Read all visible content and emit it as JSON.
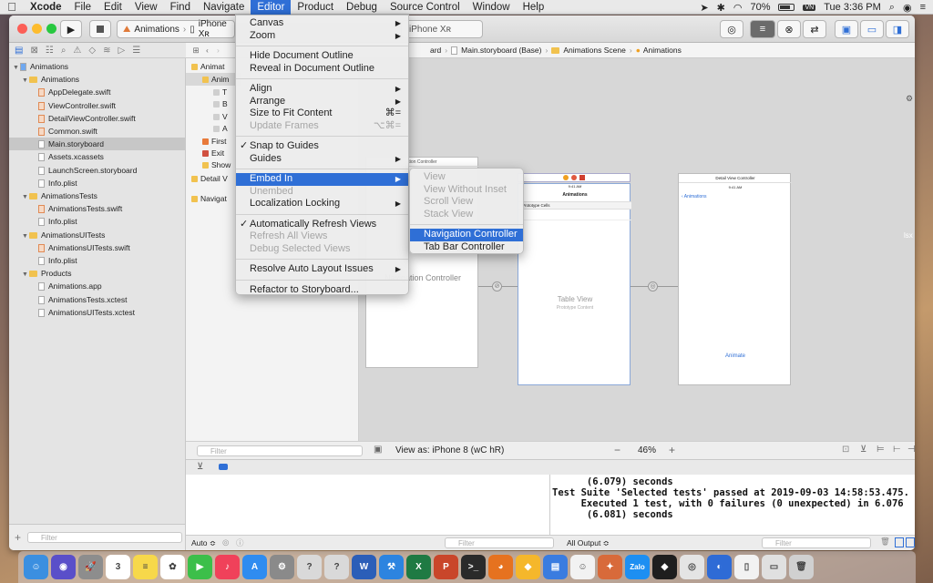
{
  "menubar": {
    "items": [
      "Xcode",
      "File",
      "Edit",
      "View",
      "Find",
      "Navigate",
      "Editor",
      "Product",
      "Debug",
      "Source Control",
      "Window",
      "Help"
    ],
    "battery": "70%",
    "clock": "Tue 3:36 PM"
  },
  "toolbar": {
    "scheme": "Animations",
    "device": "iPhone Xʀ"
  },
  "jumpbar": {
    "crumbs": [
      "ard",
      "Main.storyboard (Base)",
      "Animations Scene",
      "Animations"
    ]
  },
  "navigator": {
    "items": [
      {
        "label": "Animations",
        "type": "project",
        "indent": 0
      },
      {
        "label": "Animations",
        "type": "folder",
        "indent": 1
      },
      {
        "label": "AppDelegate.swift",
        "type": "swift",
        "indent": 2
      },
      {
        "label": "ViewController.swift",
        "type": "swift",
        "indent": 2
      },
      {
        "label": "DetailViewController.swift",
        "type": "swift",
        "indent": 2
      },
      {
        "label": "Common.swift",
        "type": "swift",
        "indent": 2
      },
      {
        "label": "Main.storyboard",
        "type": "storyboard",
        "indent": 2,
        "selected": true
      },
      {
        "label": "Assets.xcassets",
        "type": "assets",
        "indent": 2
      },
      {
        "label": "LaunchScreen.storyboard",
        "type": "storyboard",
        "indent": 2
      },
      {
        "label": "Info.plist",
        "type": "plist",
        "indent": 2
      },
      {
        "label": "AnimationsTests",
        "type": "folder",
        "indent": 1
      },
      {
        "label": "AnimationsTests.swift",
        "type": "swift",
        "indent": 2
      },
      {
        "label": "Info.plist",
        "type": "plist",
        "indent": 2
      },
      {
        "label": "AnimationsUITests",
        "type": "folder",
        "indent": 1
      },
      {
        "label": "AnimationsUITests.swift",
        "type": "swift",
        "indent": 2
      },
      {
        "label": "Info.plist",
        "type": "plist",
        "indent": 2
      },
      {
        "label": "Products",
        "type": "folder",
        "indent": 1
      },
      {
        "label": "Animations.app",
        "type": "app",
        "indent": 2
      },
      {
        "label": "AnimationsTests.xctest",
        "type": "file",
        "indent": 2
      },
      {
        "label": "AnimationsUITests.xctest",
        "type": "file",
        "indent": 2
      }
    ],
    "filter_placeholder": "Filter"
  },
  "outline": {
    "items": [
      {
        "label": "Animat",
        "indent": 0
      },
      {
        "label": "Anim",
        "indent": 1
      },
      {
        "label": "T",
        "indent": 2
      },
      {
        "label": "B",
        "indent": 2
      },
      {
        "label": "V",
        "indent": 2
      },
      {
        "label": "A",
        "indent": 2
      },
      {
        "label": "First",
        "indent": 1
      },
      {
        "label": "Exit",
        "indent": 1
      },
      {
        "label": "Show",
        "indent": 1
      },
      {
        "label": "Detail V",
        "indent": 0
      },
      {
        "label": "Navigat",
        "indent": 0
      }
    ],
    "filter_placeholder": "Filter"
  },
  "canvas": {
    "nav_controller_label": "Navigation Controller",
    "nav_scene_title": "tion Controller",
    "table_scene": {
      "time": "9:41 AM",
      "title": "Animations",
      "section": "Prototype Cells",
      "center": "Table View",
      "center_sub": "Prototype Content"
    },
    "detail_scene": {
      "header": "Detail View Controller",
      "time": "9:41 AM",
      "back": "Animations",
      "button": "Animate"
    },
    "view_as": "View as: iPhone 8 (wC hR)",
    "zoom": "46%",
    "side_fragment": "lsx"
  },
  "editor_menu": {
    "items": [
      {
        "label": "Canvas",
        "submenu": true
      },
      {
        "label": "Zoom",
        "submenu": true
      },
      {
        "sep": true
      },
      {
        "label": "Hide Document Outline"
      },
      {
        "label": "Reveal in Document Outline"
      },
      {
        "sep": true
      },
      {
        "label": "Align",
        "submenu": true
      },
      {
        "label": "Arrange",
        "submenu": true
      },
      {
        "label": "Size to Fit Content",
        "shortcut": "⌘="
      },
      {
        "label": "Update Frames",
        "shortcut": "⌥⌘=",
        "disabled": true
      },
      {
        "sep": true
      },
      {
        "label": "Snap to Guides",
        "checked": true
      },
      {
        "label": "Guides",
        "submenu": true
      },
      {
        "sep": true
      },
      {
        "label": "Embed In",
        "submenu": true,
        "highlighted": true
      },
      {
        "label": "Unembed",
        "disabled": true
      },
      {
        "label": "Localization Locking",
        "submenu": true
      },
      {
        "sep": true
      },
      {
        "label": "Automatically Refresh Views",
        "checked": true
      },
      {
        "label": "Refresh All Views",
        "disabled": true
      },
      {
        "label": "Debug Selected Views",
        "disabled": true
      },
      {
        "sep": true
      },
      {
        "label": "Resolve Auto Layout Issues",
        "submenu": true
      },
      {
        "sep": true
      },
      {
        "label": "Refactor to Storyboard..."
      }
    ]
  },
  "embed_menu": {
    "items": [
      {
        "label": "View",
        "disabled": true
      },
      {
        "label": "View Without Inset",
        "disabled": true
      },
      {
        "label": "Scroll View",
        "disabled": true
      },
      {
        "label": "Stack View",
        "disabled": true
      },
      {
        "sep": true
      },
      {
        "label": "Navigation Controller",
        "highlighted": true
      },
      {
        "label": "Tab Bar Controller"
      }
    ]
  },
  "debug": {
    "vars_auto": "Auto ≎",
    "filter_placeholder": "Filter",
    "output_select": "All Output ≎",
    "console_lines": [
      "      (6.079) seconds",
      "Test Suite 'Selected tests' passed at 2019-09-03 14:58:53.475.",
      "     Executed 1 test, with 0 failures (0 unexpected) in 6.076",
      "      (6.081) seconds"
    ]
  },
  "dock": {
    "apps": [
      {
        "name": "finder",
        "color": "#3b8fe0",
        "glyph": "☺"
      },
      {
        "name": "siri",
        "color": "#5a4fc9",
        "glyph": "◉"
      },
      {
        "name": "launchpad",
        "color": "#8d8d8d",
        "glyph": "🚀"
      },
      {
        "name": "calendar",
        "color": "#ffffff",
        "glyph": "3"
      },
      {
        "name": "notes",
        "color": "#f7d84a",
        "glyph": "≡"
      },
      {
        "name": "photos",
        "color": "#ffffff",
        "glyph": "✿"
      },
      {
        "name": "facetime",
        "color": "#3cbf4a",
        "glyph": "▶"
      },
      {
        "name": "music",
        "color": "#f0415a",
        "glyph": "♪"
      },
      {
        "name": "appstore",
        "color": "#2f8cf0",
        "glyph": "A"
      },
      {
        "name": "preferences",
        "color": "#8a8a8a",
        "glyph": "⚙"
      },
      {
        "name": "help1",
        "color": "#d9d9d9",
        "glyph": "?"
      },
      {
        "name": "help2",
        "color": "#d9d9d9",
        "glyph": "?"
      },
      {
        "name": "word",
        "color": "#2b5eb8",
        "glyph": "W"
      },
      {
        "name": "xcode",
        "color": "#2c84e0",
        "glyph": "⚒"
      },
      {
        "name": "excel",
        "color": "#1f7a43",
        "glyph": "X"
      },
      {
        "name": "powerpoint",
        "color": "#c9462a",
        "glyph": "P"
      },
      {
        "name": "terminal",
        "color": "#2a2a2a",
        "glyph": ">_"
      },
      {
        "name": "firefox",
        "color": "#e6721f",
        "glyph": "◕"
      },
      {
        "name": "sketch",
        "color": "#f5b72b",
        "glyph": "◆"
      },
      {
        "name": "files",
        "color": "#3a7ce0",
        "glyph": "▤"
      },
      {
        "name": "emoji",
        "color": "#f2f2f2",
        "glyph": "☺"
      },
      {
        "name": "safari-like",
        "color": "#d86a3a",
        "glyph": "✦"
      },
      {
        "name": "zalo",
        "color": "#1d8ff2",
        "glyph": "Zalo"
      },
      {
        "name": "figma",
        "color": "#1e1e1e",
        "glyph": "◆"
      },
      {
        "name": "chrome",
        "color": "#e4e4e4",
        "glyph": "◎"
      },
      {
        "name": "unknown",
        "color": "#2e6bd6",
        "glyph": "◐"
      },
      {
        "name": "document",
        "color": "#f2f2f2",
        "glyph": "▯"
      },
      {
        "name": "document2",
        "color": "#e0e0e0",
        "glyph": "▭"
      },
      {
        "name": "trash",
        "color": "#d0d0d0",
        "glyph": "🗑"
      }
    ]
  }
}
